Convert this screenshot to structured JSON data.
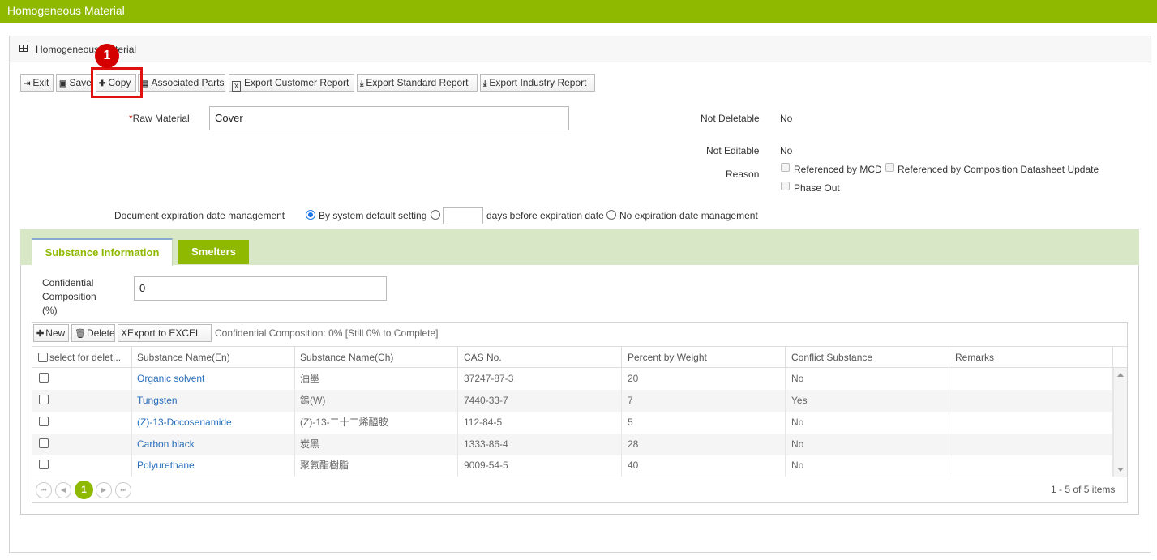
{
  "app": {
    "title": "Homogeneous Material"
  },
  "panel": {
    "title": "Homogeneous Material"
  },
  "annotation": {
    "step": "1"
  },
  "toolbar": {
    "exit": "Exit",
    "save": "Save",
    "copy": "Copy",
    "associated_parts": "Associated Parts",
    "export_customer": "Export Customer Report",
    "export_standard": "Export Standard Report",
    "export_industry": "Export Industry Report"
  },
  "form": {
    "raw_material_label": "Raw Material",
    "raw_material_value": "Cover",
    "not_deletable_label": "Not Deletable",
    "not_deletable_value": "No",
    "not_editable_label": "Not Editable",
    "not_editable_value": "No",
    "reason_label": "Reason",
    "reason_options": [
      "Referenced by MCD",
      "Referenced by Composition Datasheet Update",
      "Phase Out"
    ],
    "doc_exp_label": "Document expiration date management",
    "exp_option_default": "By system default setting",
    "exp_option_days": "days before expiration date",
    "exp_option_none": "No expiration date management",
    "days_value": ""
  },
  "tabs": {
    "substance": "Substance Information",
    "smelters": "Smelters"
  },
  "confidential": {
    "label_line1": "Confidential",
    "label_line2": "Composition",
    "label_line3": "(%)",
    "value": "0"
  },
  "grid": {
    "new": "New",
    "delete": "Delete",
    "export_excel": "Export to EXCEL",
    "summary": "Confidential Composition: 0% [Still 0% to Complete]",
    "columns": [
      "select for delet...",
      "Substance Name(En)",
      "Substance Name(Ch)",
      "CAS No.",
      "Percent by Weight",
      "Conflict Substance",
      "Remarks"
    ],
    "rows": [
      {
        "name_en": "Organic solvent",
        "name_ch": "油墨",
        "cas": "37247-87-3",
        "percent": "20",
        "conflict": "No",
        "remarks": ""
      },
      {
        "name_en": "Tungsten",
        "name_ch": "鎢(W)",
        "cas": "7440-33-7",
        "percent": "7",
        "conflict": "Yes",
        "remarks": ""
      },
      {
        "name_en": "(Z)-13-Docosenamide",
        "name_ch": "(Z)-13-二十二烯醯胺",
        "cas": "112-84-5",
        "percent": "5",
        "conflict": "No",
        "remarks": ""
      },
      {
        "name_en": "Carbon black",
        "name_ch": "炭黑",
        "cas": "1333-86-4",
        "percent": "28",
        "conflict": "No",
        "remarks": ""
      },
      {
        "name_en": "Polyurethane",
        "name_ch": "聚氨酯樹脂",
        "cas": "9009-54-5",
        "percent": "40",
        "conflict": "No",
        "remarks": ""
      }
    ],
    "pager": {
      "current": "1",
      "info": "1 - 5 of 5 items"
    }
  },
  "colors": {
    "brand": "#8fb800",
    "tab_strip": "#d8e7c6",
    "link": "#2a6ebb",
    "highlight": "#e01010"
  }
}
